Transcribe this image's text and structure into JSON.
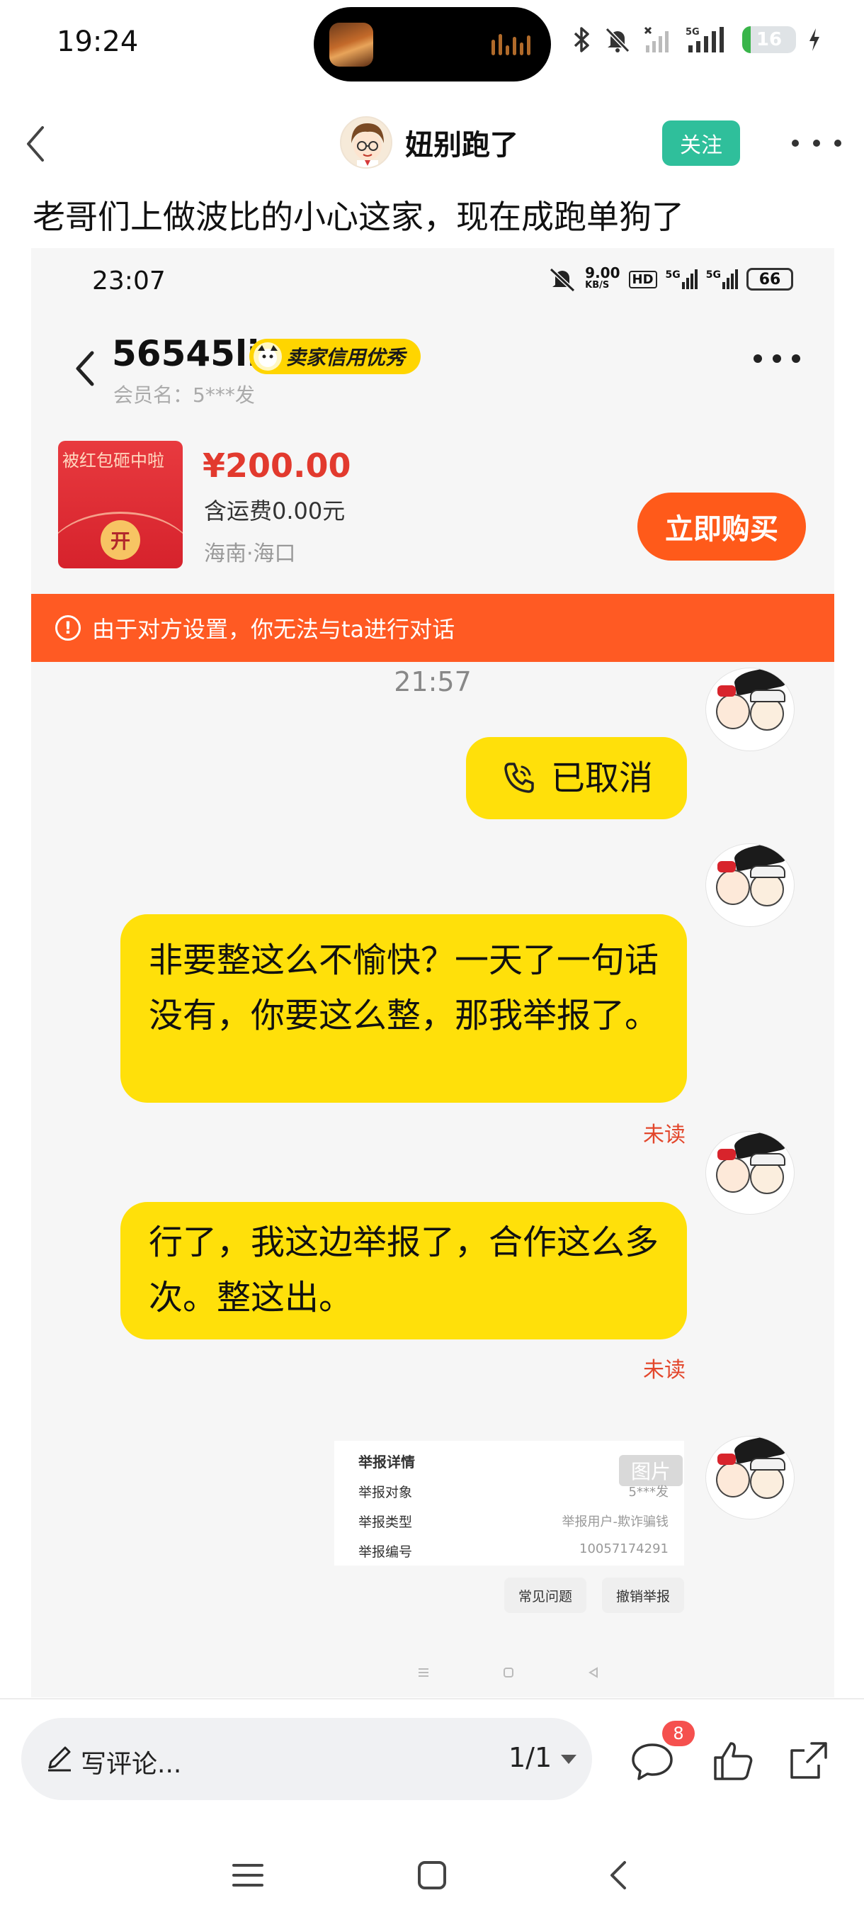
{
  "status_bar": {
    "time": "19:24",
    "battery": "16",
    "battery_level": 0.16
  },
  "header": {
    "author_name": "妞别跑了",
    "follow_label": "关注"
  },
  "post": {
    "text": "老哥们上做波比的小心这家，现在成跑单狗了"
  },
  "screenshot": {
    "status": {
      "time": "23:07",
      "net_speed_top": "9.00",
      "net_speed_unit": "KB/S",
      "hd": "HD",
      "net_5g_1": "5G",
      "net_5g_2": "5G",
      "battery": "66"
    },
    "chat_header": {
      "seller_name": "56545li",
      "badge": "卖家信用优秀",
      "member": "会员名：5***发"
    },
    "product": {
      "image_text": "被红包砸中啦",
      "image_button": "开",
      "price": "¥200.00",
      "shipping": "含运费0.00元",
      "location": "海南·海口",
      "buy_label": "立即购买"
    },
    "notice": "由于对方设置，你无法与ta进行对话",
    "chat_time": "21:57",
    "messages": [
      {
        "text": "已取消"
      },
      {
        "text": "非要整这么不愉快？一天了一句话没有，你要这么整，那我举报了。",
        "status": "未读"
      },
      {
        "text": "行了，我这边举报了，合作这么多次。整这出。",
        "status": "未读"
      }
    ],
    "report_card": {
      "title": "举报详情",
      "pic_tag": "图片",
      "rows": [
        {
          "label": "举报对象",
          "value": "5***发"
        },
        {
          "label": "举报类型",
          "value": "举报用户-欺诈骗钱"
        },
        {
          "label": "举报编号",
          "value": "10057174291"
        }
      ],
      "faq_button": "常见问题",
      "cancel_button": "撤销举报"
    }
  },
  "bottom_bar": {
    "comment_placeholder": "写评论...",
    "page_indicator": "1/1",
    "comment_count_badge": "8"
  }
}
